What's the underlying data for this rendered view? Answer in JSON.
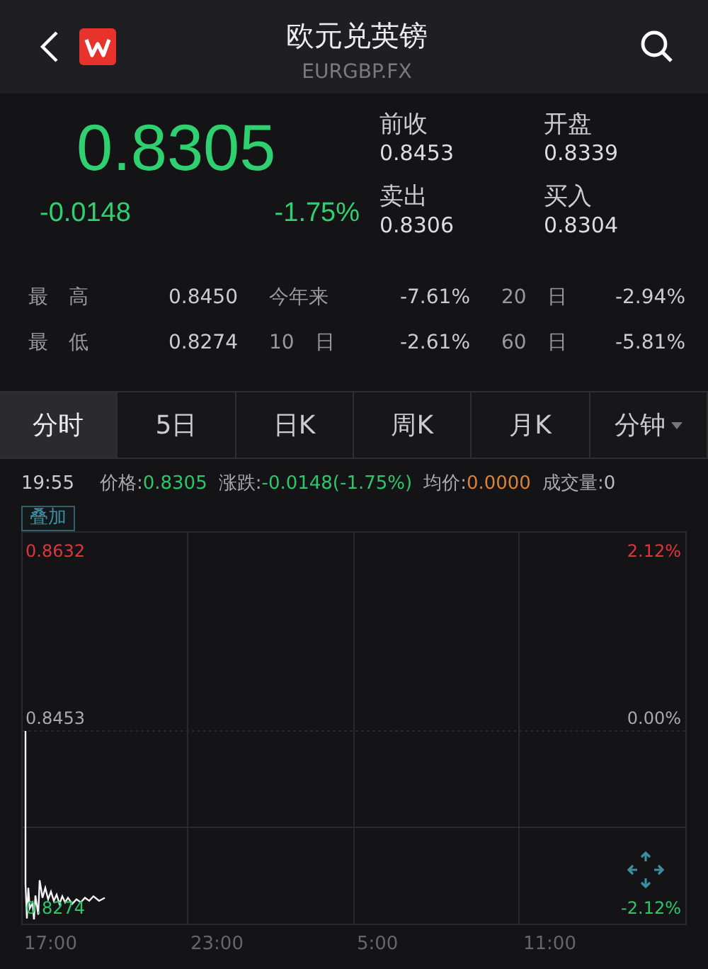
{
  "header": {
    "title": "欧元兑英镑",
    "code": "EURGBP.FX"
  },
  "quote": {
    "price": "0.8305",
    "change": "-0.0148",
    "change_pct": "-1.75%"
  },
  "quote_fields": [
    {
      "label": "前收",
      "value": "0.8453"
    },
    {
      "label": "开盘",
      "value": "0.8339"
    },
    {
      "label": "卖出",
      "value": "0.8306"
    },
    {
      "label": "买入",
      "value": "0.8304"
    }
  ],
  "stats": [
    [
      {
        "label": "最 高",
        "value": "0.8450"
      },
      {
        "label": "今年来",
        "value": "-7.61%"
      },
      {
        "label": "20 日",
        "value": "-2.94%"
      }
    ],
    [
      {
        "label": "最 低",
        "value": "0.8274"
      },
      {
        "label": "10 日",
        "value": "-2.61%"
      },
      {
        "label": "60 日",
        "value": "-5.81%"
      }
    ]
  ],
  "tabs": [
    {
      "label": "分时",
      "selected": true
    },
    {
      "label": "5日",
      "selected": false
    },
    {
      "label": "日K",
      "selected": false
    },
    {
      "label": "周K",
      "selected": false
    },
    {
      "label": "月K",
      "selected": false
    },
    {
      "label": "分钟",
      "selected": false,
      "dropdown": true
    }
  ],
  "info_bar": {
    "time": "19:55",
    "items": [
      {
        "label": "价格:",
        "value": "0.8305",
        "color": "#2fc56a"
      },
      {
        "label": "涨跌:",
        "value": "-0.0148(-1.75%)",
        "color": "#2fc56a"
      },
      {
        "label": "均价:",
        "value": "0.0000",
        "color": "#d9823c"
      },
      {
        "label": "成交量:",
        "value": "0",
        "color": "#bbbbbb"
      }
    ]
  },
  "overlay_button": "叠加",
  "chart": {
    "left_labels": [
      {
        "text": "0.8632",
        "color": "#e0353f"
      },
      {
        "text": "0.8453",
        "color": "#aaaaaa"
      },
      {
        "text": "0.8274",
        "color": "#2fc56a"
      }
    ],
    "right_labels": [
      {
        "text": "2.12%",
        "color": "#e0353f"
      },
      {
        "text": "0.00%",
        "color": "#aaaaaa"
      },
      {
        "text": "-2.12%",
        "color": "#2fc56a"
      }
    ],
    "time_labels": [
      "17:00",
      "23:00",
      "5:00",
      "11:00"
    ]
  }
}
